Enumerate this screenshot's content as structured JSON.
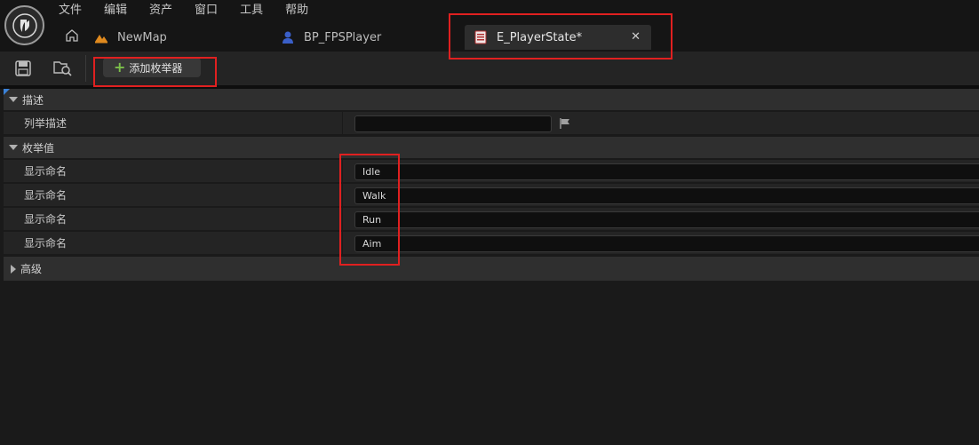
{
  "menu": [
    "文件",
    "编辑",
    "资产",
    "窗口",
    "工具",
    "帮助"
  ],
  "tabs": [
    {
      "label": "NewMap",
      "icon": "level-map-icon"
    },
    {
      "label": "BP_FPSPlayer",
      "icon": "blueprint-pawn-icon"
    },
    {
      "label": "E_PlayerState*",
      "icon": "enum-asset-icon",
      "active": true
    }
  ],
  "toolbar": {
    "add_enumerator_label": "添加枚举器",
    "icons": [
      "save-icon",
      "browse-to-asset-icon"
    ]
  },
  "details": {
    "description_section": {
      "title": "描述",
      "row_label": "列举描述",
      "row_value": ""
    },
    "enum_values_section": {
      "title": "枚举值",
      "rows": [
        {
          "label": "显示命名",
          "value": "Idle"
        },
        {
          "label": "显示命名",
          "value": "Walk"
        },
        {
          "label": "显示命名",
          "value": "Run"
        },
        {
          "label": "显示命名",
          "value": "Aim"
        }
      ]
    },
    "advanced_section": {
      "title": "高级"
    }
  },
  "colors": {
    "highlight": "#e02020",
    "accent_plus": "#7cc04a",
    "panel_bg": "#242424"
  }
}
